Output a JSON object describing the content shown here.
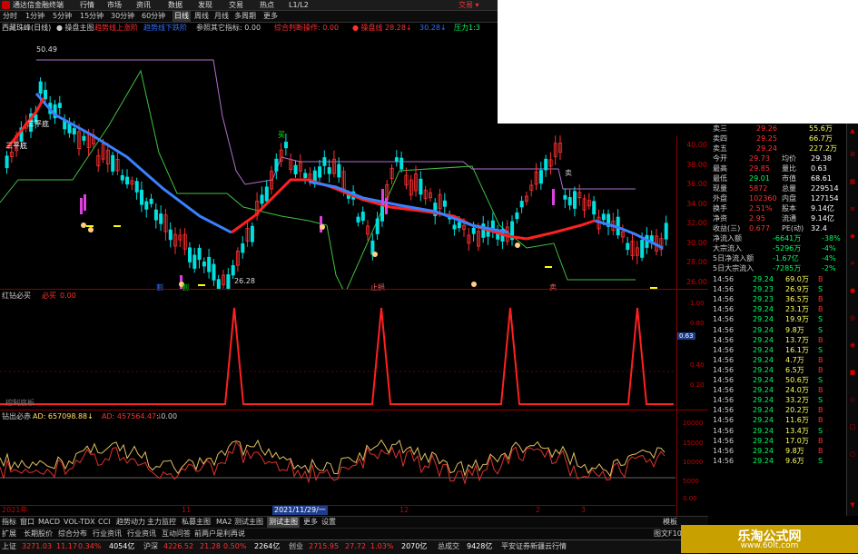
{
  "app": {
    "title": "通达信金融终端",
    "menus": [
      "行情",
      "市场",
      "资讯",
      "数据",
      "发现",
      "交易",
      "热点",
      "L1/L2"
    ],
    "trade_label": "交易 ▾"
  },
  "periods": {
    "items": [
      "分时",
      "1分钟",
      "5分钟",
      "15分钟",
      "30分钟",
      "60分钟",
      "日线",
      "周线",
      "月线",
      "多周期",
      "更多"
    ],
    "active": "日线"
  },
  "main_header": {
    "stock": "西藏珠峰(日线)",
    "items": [
      {
        "text": "● 操盘主图",
        "color": "#cccccc"
      },
      {
        "text": "趋势线上涨阶",
        "color": "#ff3030"
      },
      {
        "text": "趋势线下跌阶",
        "color": "#3070ff"
      },
      {
        "text": "参照其它指标: 0.00",
        "color": "#cccccc"
      },
      {
        "text": "综合判断操作: 0.00",
        "color": "#ff3030"
      },
      {
        "text": "● 操盘线",
        "color": "#ff3030"
      },
      {
        "text": "28.28↓",
        "color": "#ff3030"
      },
      {
        "text": "30.28↓",
        "color": "#3070ff"
      },
      {
        "text": "压力1:3",
        "color": "#00ff60"
      }
    ]
  },
  "annotations": {
    "high": "50.49",
    "low": "26.28",
    "san_ping_a": "三平底",
    "san_ping_b": "三平底",
    "dip_label": "买",
    "marks": [
      "割",
      "割",
      "止损",
      "卖",
      "卖"
    ]
  },
  "price_axis": [
    "40.00",
    "38.00",
    "36.00",
    "34.00",
    "32.00",
    "30.00",
    "28.00",
    "26.00"
  ],
  "sub1": {
    "title": "红钻必买",
    "label2": "必买",
    "value": "0.00",
    "axis": [
      "1.00",
      "0.80",
      "0.63",
      "0.40",
      "0.20"
    ],
    "current": "0.63",
    "caption": "控制底板"
  },
  "sub2": {
    "title": "钻出必赤",
    "ad_label": "AD: 657098.88↓",
    "ad2_label": "AD: 457564.47↓",
    "extra": ": 0.00",
    "axis": [
      "20000",
      "15000",
      "10000",
      "5000",
      "0.00"
    ]
  },
  "dates": {
    "start": "2021年",
    "m2": "11",
    "cursor": "2021/11/29/一",
    "m4": "12",
    "m5": "2",
    "m6": "3"
  },
  "tabs": {
    "items": [
      "指标",
      "窗口",
      "MACD",
      "VOL-TDX",
      "CCI",
      "趋势动力",
      "主力监控",
      "私募主图",
      "MA2",
      "测试主图",
      "测试主图",
      "更多",
      "设置"
    ],
    "active": "测试主图",
    "right": "模板"
  },
  "tabs2": {
    "items": [
      "扩展",
      "长期股价",
      "综合分布",
      "行业资讯",
      "行业资讯",
      "互动问答",
      "前两户是利再说"
    ],
    "right": "图文F10"
  },
  "quote_panel": {
    "top": [
      {
        "l": "卖三",
        "p": "29.26",
        "v": "55.6万"
      },
      {
        "l": "卖四",
        "p": "29.25",
        "v": "66.7万"
      },
      {
        "l": "卖五",
        "p": "29.24",
        "v": "227.2万"
      }
    ],
    "stats": [
      {
        "l1": "今开",
        "v1": "29.73",
        "l2": "均价",
        "v2": "29.38"
      },
      {
        "l1": "最高",
        "v1": "29.85",
        "l2": "量比",
        "v2": "0.63"
      },
      {
        "l1": "最低",
        "v1": "29.01",
        "l2": "市值",
        "v2": "68.61"
      },
      {
        "l1": "现量",
        "v1": "5872",
        "l2": "总量",
        "v2": "229514"
      },
      {
        "l1": "外盘",
        "v1": "102360",
        "l2": "内盘",
        "v2": "127154"
      },
      {
        "l1": "换手",
        "v1": "2.51%",
        "l2": "股本",
        "v2": "9.14亿"
      },
      {
        "l1": "净资",
        "v1": "2.95",
        "l2": "流通",
        "v2": "9.14亿"
      },
      {
        "l1": "收益(三)",
        "v1": "0.677",
        "l2": "PE(动)",
        "v2": "32.4"
      }
    ],
    "flows": [
      {
        "l": "净流入额",
        "v": "-6641万",
        "p": "-38%"
      },
      {
        "l": "大宗流入",
        "v": "-5296万",
        "p": "-4%"
      },
      {
        "l": "5日净流入额",
        "v": "-1.67亿",
        "p": "-4%"
      },
      {
        "l": "5日大宗流入",
        "v": "-7285万",
        "p": "-2%"
      }
    ],
    "ticks": [
      {
        "t": "14:56",
        "p": "29.24",
        "v": "69.0万",
        "s": "B"
      },
      {
        "t": "14:56",
        "p": "29.23",
        "v": "26.9万",
        "s": "S"
      },
      {
        "t": "14:56",
        "p": "29.23",
        "v": "36.5万",
        "s": "B"
      },
      {
        "t": "14:56",
        "p": "29.24",
        "v": "23.1万",
        "s": "B"
      },
      {
        "t": "14:56",
        "p": "29.24",
        "v": "19.9万",
        "s": "S"
      },
      {
        "t": "14:56",
        "p": "29.24",
        "v": "9.8万",
        "s": "S"
      },
      {
        "t": "14:56",
        "p": "29.24",
        "v": "13.7万",
        "s": "B"
      },
      {
        "t": "14:56",
        "p": "29.24",
        "v": "16.1万",
        "s": "S"
      },
      {
        "t": "14:56",
        "p": "29.24",
        "v": "4.7万",
        "s": "B"
      },
      {
        "t": "14:56",
        "p": "29.24",
        "v": "6.5万",
        "s": "B"
      },
      {
        "t": "14:56",
        "p": "29.24",
        "v": "50.6万",
        "s": "S"
      },
      {
        "t": "14:56",
        "p": "29.24",
        "v": "24.0万",
        "s": "B"
      },
      {
        "t": "14:56",
        "p": "29.24",
        "v": "33.2万",
        "s": "S"
      },
      {
        "t": "14:56",
        "p": "29.24",
        "v": "20.2万",
        "s": "B"
      },
      {
        "t": "14:56",
        "p": "29.24",
        "v": "11.6万",
        "s": "B"
      },
      {
        "t": "14:56",
        "p": "29.24",
        "v": "13.4万",
        "s": "S"
      },
      {
        "t": "14:56",
        "p": "29.24",
        "v": "17.0万",
        "s": "B"
      },
      {
        "t": "14:56",
        "p": "29.24",
        "v": "9.8万",
        "s": "B"
      },
      {
        "t": "14:56",
        "p": "29.24",
        "v": "9.6万",
        "s": "S"
      }
    ]
  },
  "status": {
    "items": [
      {
        "text": "上证",
        "color": "#cccccc"
      },
      {
        "text": "3271.03",
        "color": "#ff3030"
      },
      {
        "text": "11.17",
        "color": "#ff3030"
      },
      {
        "text": "0.34%",
        "color": "#ff3030"
      },
      {
        "text": "4054亿",
        "color": "#ffffff"
      },
      {
        "text": "沪深",
        "color": "#cccccc"
      },
      {
        "text": "4226.52",
        "color": "#ff3030"
      },
      {
        "text": "21.28",
        "color": "#ff3030"
      },
      {
        "text": "0.50%",
        "color": "#ff3030"
      },
      {
        "text": "2264亿",
        "color": "#ffffff"
      },
      {
        "text": "创业",
        "color": "#cccccc"
      },
      {
        "text": "2715.95",
        "color": "#ff3030"
      },
      {
        "text": "27.72",
        "color": "#ff3030"
      },
      {
        "text": "1.03%",
        "color": "#ff3030"
      },
      {
        "text": "2070亿",
        "color": "#ffffff"
      },
      {
        "text": "总成交",
        "color": "#cccccc"
      },
      {
        "text": "9428亿",
        "color": "#ffffff"
      },
      {
        "text": "平安证券新疆云行情",
        "color": "#cccccc"
      }
    ]
  },
  "watermark": {
    "line1": "乐淘公式网",
    "line2": "www.60lt.com"
  },
  "colors": {
    "up": "#ff3030",
    "down": "#00e0e0",
    "blue_line": "#3a80ff",
    "red_line": "#ff2020",
    "purple_line": "#b070d0",
    "green_line": "#40c040",
    "volume": "#ffff00"
  }
}
